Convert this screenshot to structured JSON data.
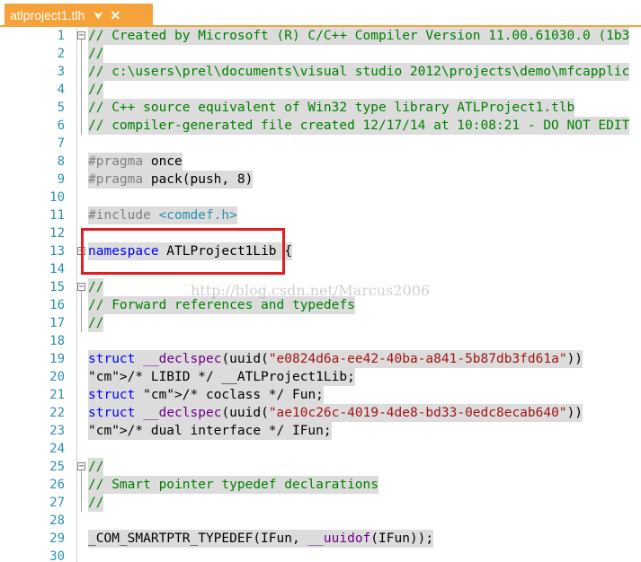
{
  "tab": {
    "title": "atlproject1.tlh",
    "pin_icon": "pin-icon",
    "close_icon": "close-icon"
  },
  "watermark": "http://blog.csdn.net/Marcus2006",
  "lines": [
    {
      "n": "1",
      "t": "// Created by Microsoft (R) C/C++ Compiler Version 11.00.61030.0 (1b3"
    },
    {
      "n": "2",
      "t": "//"
    },
    {
      "n": "3",
      "t": "// c:\\users\\prel\\documents\\visual studio 2012\\projects\\demo\\mfcapplic"
    },
    {
      "n": "4",
      "t": "//"
    },
    {
      "n": "5",
      "t": "// C++ source equivalent of Win32 type library ATLProject1.tlb"
    },
    {
      "n": "6",
      "t": "// compiler-generated file created 12/17/14 at 10:08:21 - DO NOT EDIT"
    },
    {
      "n": "7",
      "t": ""
    },
    {
      "n": "8",
      "t": "#pragma once"
    },
    {
      "n": "9",
      "t": "#pragma pack(push, 8)"
    },
    {
      "n": "10",
      "t": ""
    },
    {
      "n": "11",
      "t": "#include <comdef.h>"
    },
    {
      "n": "12",
      "t": ""
    },
    {
      "n": "13",
      "t": "namespace ATLProject1Lib {"
    },
    {
      "n": "14",
      "t": ""
    },
    {
      "n": "15",
      "t": "//"
    },
    {
      "n": "16",
      "t": "// Forward references and typedefs"
    },
    {
      "n": "17",
      "t": "//"
    },
    {
      "n": "18",
      "t": ""
    },
    {
      "n": "19",
      "t": "struct __declspec(uuid(\"e0824d6a-ee42-40ba-a841-5b87db3fd61a\"))"
    },
    {
      "n": "20",
      "t": "/* LIBID */ __ATLProject1Lib;"
    },
    {
      "n": "21",
      "t": "struct /* coclass */ Fun;"
    },
    {
      "n": "22",
      "t": "struct __declspec(uuid(\"ae10c26c-4019-4de8-bd33-0edc8ecab640\"))"
    },
    {
      "n": "23",
      "t": "/* dual interface */ IFun;"
    },
    {
      "n": "24",
      "t": ""
    },
    {
      "n": "25",
      "t": "//"
    },
    {
      "n": "26",
      "t": "// Smart pointer typedef declarations"
    },
    {
      "n": "27",
      "t": "//"
    },
    {
      "n": "28",
      "t": ""
    },
    {
      "n": "29",
      "t": "_COM_SMARTPTR_TYPEDEF(IFun, __uuidof(IFun));"
    },
    {
      "n": "30",
      "t": ""
    }
  ]
}
